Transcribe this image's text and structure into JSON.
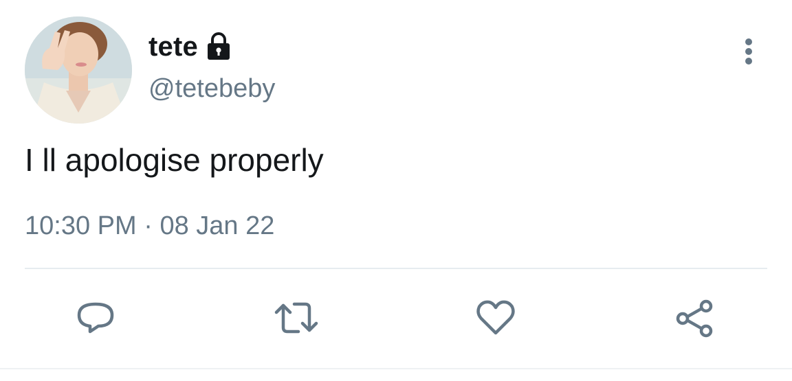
{
  "tweet": {
    "display_name": "tete",
    "handle": "@tetebeby",
    "text": "I ll apologise properly",
    "time": "10:30 PM",
    "separator": "·",
    "date": "08 Jan 22",
    "account_locked_icon": "lock-icon",
    "avatar_icon": "profile-photo"
  },
  "actions": {
    "reply_icon": "reply-icon",
    "retweet_icon": "retweet-icon",
    "like_icon": "heart-icon",
    "share_icon": "share-icon"
  },
  "colors": {
    "text_primary": "#14171a",
    "text_secondary": "#657786",
    "icon": "#657786",
    "divider": "#e6ecf0"
  }
}
